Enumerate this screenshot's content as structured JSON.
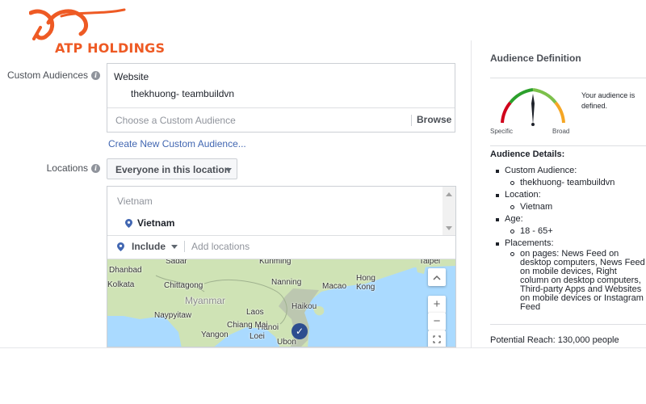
{
  "logo": {
    "text": "ATP HOLDINGS",
    "color": "#ee5a24"
  },
  "custom_audiences": {
    "label": "Custom Audiences",
    "website_label": "Website",
    "selected": "thekhuong- teambuildvn",
    "placeholder": "Choose a Custom Audience",
    "browse_label": "Browse",
    "create_link": "Create New Custom Audience..."
  },
  "locations": {
    "label": "Locations",
    "dropdown_value": "Everyone in this location",
    "group": "Vietnam",
    "item": "Vietnam",
    "include_label": "Include",
    "add_placeholder": "Add locations"
  },
  "map": {
    "labels": [
      "Dhanbad",
      "Sadar",
      "Kunming",
      "Taipei",
      "Kolkata",
      "Chittagong",
      "Nanning",
      "Macao",
      "Hong Kong",
      "Myanmar",
      "Haikou",
      "Naypyitaw",
      "Laos",
      "Hanoi",
      "Yangon",
      "Chiang Mai",
      "Loei",
      "Ubon"
    ],
    "zoom_in": "+",
    "zoom_out": "−",
    "land_color": "#cfe3b5",
    "water_color": "#aadaff",
    "highlight_color": "#bcc7b0",
    "marker_color": "#2d4d8f"
  },
  "audience_definition": {
    "title": "Audience Definition",
    "status_text": "Your audience is defined.",
    "gauge_low": "Specific",
    "gauge_high": "Broad",
    "details_title": "Audience Details:",
    "details": [
      {
        "label": "Custom Audience:",
        "values": [
          "thekhuong- teambuildvn"
        ]
      },
      {
        "label": "Location:",
        "values": [
          "Vietnam"
        ]
      },
      {
        "label": "Age:",
        "values": [
          "18 - 65+"
        ]
      },
      {
        "label": "Placements:",
        "values": [
          "on pages: News Feed on desktop computers, News Feed on mobile devices, Right column on desktop computers, Third-party Apps and Websites on mobile devices or Instagram Feed"
        ]
      }
    ],
    "potential_reach": "Potential Reach: 130,000 people"
  }
}
